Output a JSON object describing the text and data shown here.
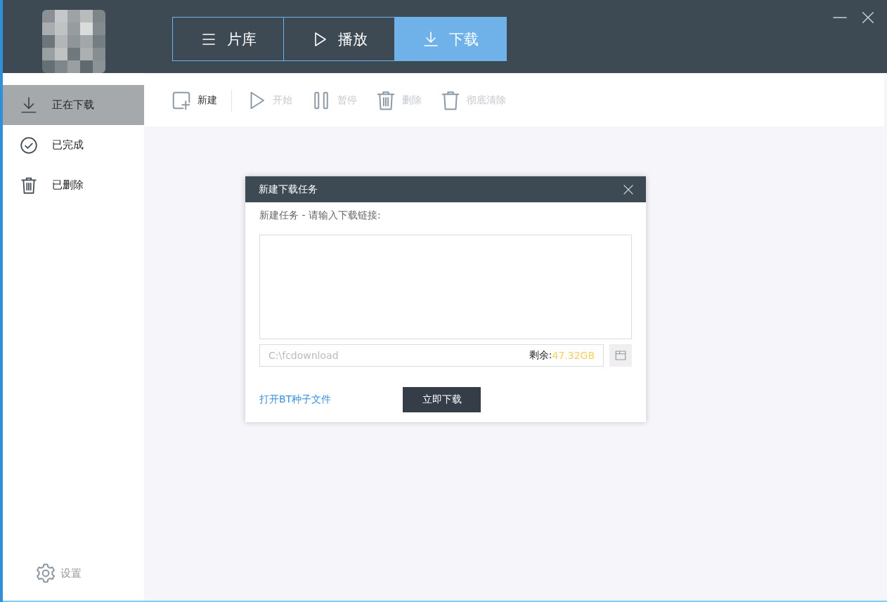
{
  "window": {
    "controls": [
      {
        "kind": "minimize"
      },
      {
        "kind": "close"
      }
    ]
  },
  "tabs": [
    {
      "label": "片库",
      "kind": "menu",
      "selected": false
    },
    {
      "label": "播放",
      "kind": "play",
      "selected": false
    },
    {
      "label": "下载",
      "kind": "download",
      "selected": true
    }
  ],
  "sidebar": {
    "items": [
      {
        "label": "正在下载",
        "kind": "download",
        "selected": true
      },
      {
        "label": "已完成",
        "kind": "check",
        "selected": false
      },
      {
        "label": "已删除",
        "kind": "trash",
        "selected": false
      }
    ],
    "settings": "设置"
  },
  "toolbar": [
    {
      "label": "新建",
      "kind": "new",
      "disabled": false
    },
    {
      "label": "开始",
      "kind": "play",
      "disabled": true
    },
    {
      "label": "暂停",
      "kind": "pause",
      "disabled": true
    },
    {
      "label": "删除",
      "kind": "trash",
      "disabled": true
    },
    {
      "label": "彻底清除",
      "kind": "clear",
      "disabled": true
    }
  ],
  "dialog": {
    "title": "新建下载任务",
    "prompt": "新建任务 - 请输入下载链接:",
    "path": "C:\\fcdownload",
    "free_label": "剩余:",
    "free_value": "47.32GB",
    "torrent_link": "打开BT种子文件",
    "submit": "立即下载"
  }
}
